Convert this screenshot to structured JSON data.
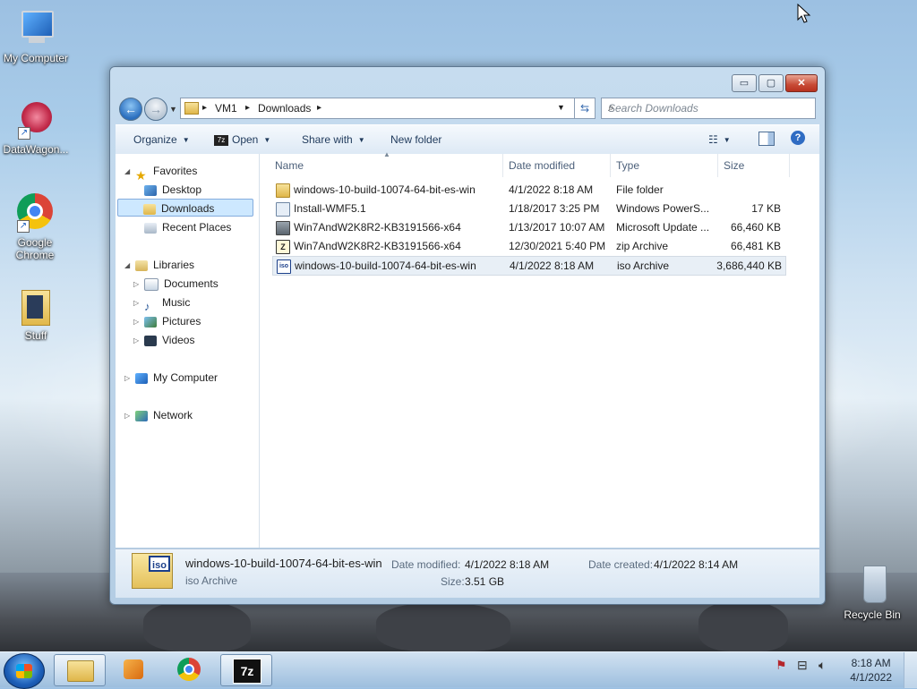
{
  "desktop": {
    "icons": [
      {
        "label": "My Computer"
      },
      {
        "label": "DataWagon..."
      },
      {
        "label": "Google Chrome"
      },
      {
        "label": "Stuff"
      },
      {
        "label": "Recycle Bin"
      }
    ]
  },
  "window": {
    "controls": {
      "minimize": "▭",
      "maximize": "▢",
      "close": "✕"
    },
    "address": {
      "segments": [
        "VM1",
        "Downloads"
      ],
      "separator": "▸"
    },
    "search": {
      "placeholder": "Search Downloads"
    },
    "toolbar": {
      "organize": "Organize",
      "open": "Open",
      "share_with": "Share with",
      "new_folder": "New folder"
    },
    "nav": {
      "favorites": {
        "label": "Favorites",
        "items": [
          "Desktop",
          "Downloads",
          "Recent Places"
        ]
      },
      "libraries": {
        "label": "Libraries",
        "items": [
          "Documents",
          "Music",
          "Pictures",
          "Videos"
        ]
      },
      "computer": "My Computer",
      "network": "Network"
    },
    "columns": {
      "name": "Name",
      "date": "Date modified",
      "type": "Type",
      "size": "Size"
    },
    "files": [
      {
        "name": "windows-10-build-10074-64-bit-es-win",
        "date": "4/1/2022 8:18 AM",
        "type": "File folder",
        "size": "",
        "icon": "folder-icon"
      },
      {
        "name": "Install-WMF5.1",
        "date": "1/18/2017 3:25 PM",
        "type": "Windows PowerS...",
        "size": "17 KB",
        "icon": "powershell-file-icon"
      },
      {
        "name": "Win7AndW2K8R2-KB3191566-x64",
        "date": "1/13/2017 10:07 AM",
        "type": "Microsoft Update ...",
        "size": "66,460 KB",
        "icon": "msu-file-icon"
      },
      {
        "name": "Win7AndW2K8R2-KB3191566-x64",
        "date": "12/30/2021 5:40 PM",
        "type": "zip Archive",
        "size": "66,481 KB",
        "icon": "7z-zip-icon"
      },
      {
        "name": "windows-10-build-10074-64-bit-es-win",
        "date": "4/1/2022 8:18 AM",
        "type": "iso Archive",
        "size": "3,686,440 KB",
        "icon": "iso-file-icon"
      }
    ],
    "details": {
      "icon_text": "iso",
      "name": "windows-10-build-10074-64-bit-es-win",
      "type": "iso Archive",
      "modified_label": "Date modified:",
      "modified": "4/1/2022 8:18 AM",
      "created_label": "Date created:",
      "created": "4/1/2022 8:14 AM",
      "size_label": "Size:",
      "size": "3.51 GB"
    }
  },
  "taskbar": {
    "seven_zip_label": "7z",
    "clock": {
      "time": "8:18 AM",
      "date": "4/1/2022"
    }
  },
  "colors": {
    "selection": "#cde8ff",
    "accent": "#1d5fb8"
  }
}
